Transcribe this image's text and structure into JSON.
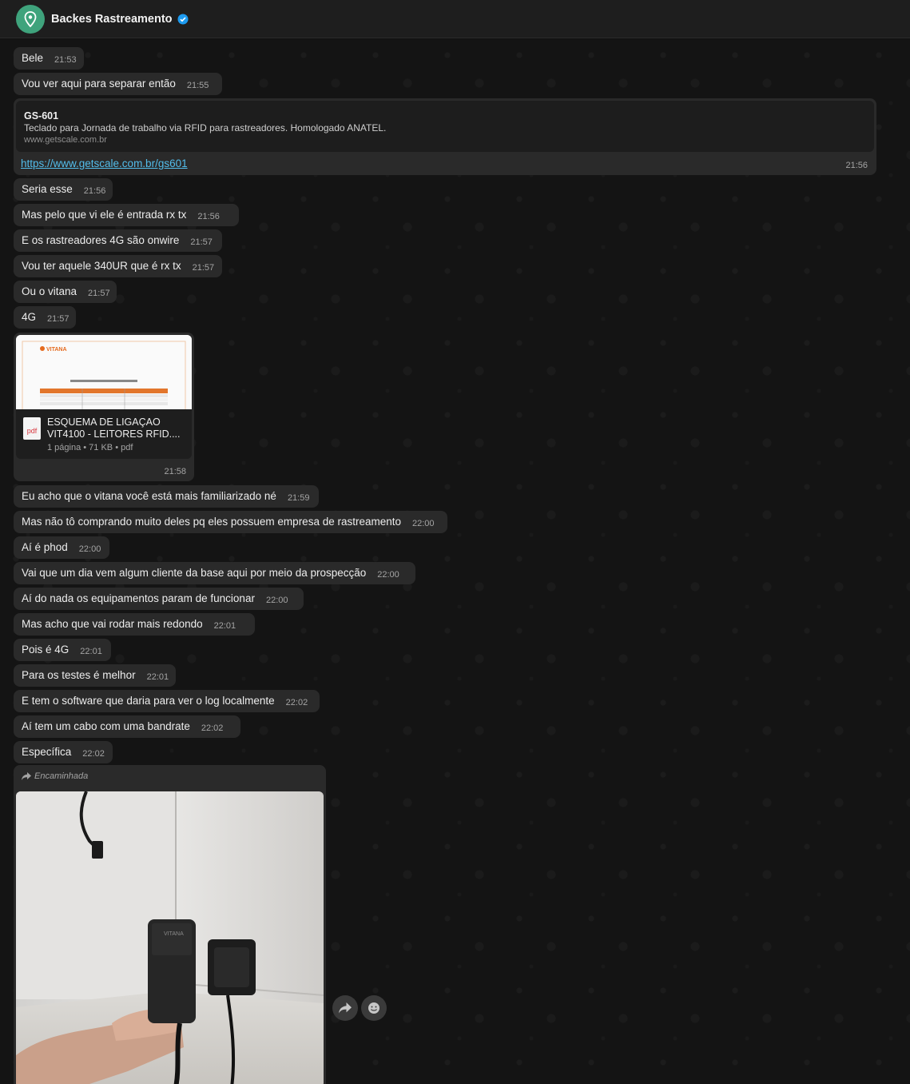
{
  "header": {
    "title": "Backes Rastreamento"
  },
  "messages": [
    {
      "text": "Bele",
      "time": "21:53"
    },
    {
      "text": "Vou ver aqui para separar então",
      "time": "21:55"
    },
    {
      "text": "Seria esse",
      "time": "21:56"
    },
    {
      "text": "Mas pelo que vi ele é entrada rx tx",
      "time": "21:56"
    },
    {
      "text": "E os rastreadores 4G são onwire",
      "time": "21:57"
    },
    {
      "text": "Vou ter aquele 340UR que é rx tx",
      "time": "21:57"
    },
    {
      "text": "Ou o vitana",
      "time": "21:57"
    },
    {
      "text": "4G",
      "time": "21:57"
    },
    {
      "text": "Eu acho que o vitana você está mais familiarizado né",
      "time": "21:59"
    },
    {
      "text": "Mas não tô comprando muito deles pq eles possuem empresa de rastreamento",
      "time": "22:00"
    },
    {
      "text": "Aí é phod",
      "time": "22:00"
    },
    {
      "text": "Vai que um dia vem algum cliente da base aqui por meio da prospecção",
      "time": "22:00"
    },
    {
      "text": "Aí do nada os equipamentos param de funcionar",
      "time": "22:00"
    },
    {
      "text": "Mas acho que vai rodar mais redondo",
      "time": "22:01"
    },
    {
      "text": "Pois é 4G",
      "time": "22:01"
    },
    {
      "text": "Para os testes é melhor",
      "time": "22:01"
    },
    {
      "text": "E tem o software que daria para ver o log localmente",
      "time": "22:02"
    },
    {
      "text": "Aí tem um cabo com uma bandrate",
      "time": "22:02"
    },
    {
      "text": "Específica",
      "time": "22:02"
    }
  ],
  "link_message": {
    "preview_title": "GS-601",
    "preview_description": "Teclado para Jornada de trabalho via RFID para rastreadores. Homologado ANATEL.",
    "preview_domain": "www.getscale.com.br",
    "url": "https://www.getscale.com.br/gs601",
    "time": "21:56"
  },
  "document_message": {
    "icon_label": "pdf",
    "name_line1": "ESQUEMA DE LIGAÇAO",
    "name_line2": "VIT4100 - LEITORES RFID....",
    "meta": "1 página • 71 KB • pdf",
    "time": "21:58",
    "thumb_logo": "VITANA"
  },
  "image_message": {
    "forwarded_label": "Encaminhada",
    "device_label": "VITANA"
  },
  "icons": {
    "avatar": "location-pin-icon",
    "verified": "verified-badge-icon",
    "forward": "forward-icon",
    "react": "emoji-icon"
  },
  "colors": {
    "background": "#111111",
    "bubble": "#2a2a2a",
    "link": "#53bdeb",
    "avatar": "#3fa37c",
    "verified": "#1d9bf0"
  }
}
